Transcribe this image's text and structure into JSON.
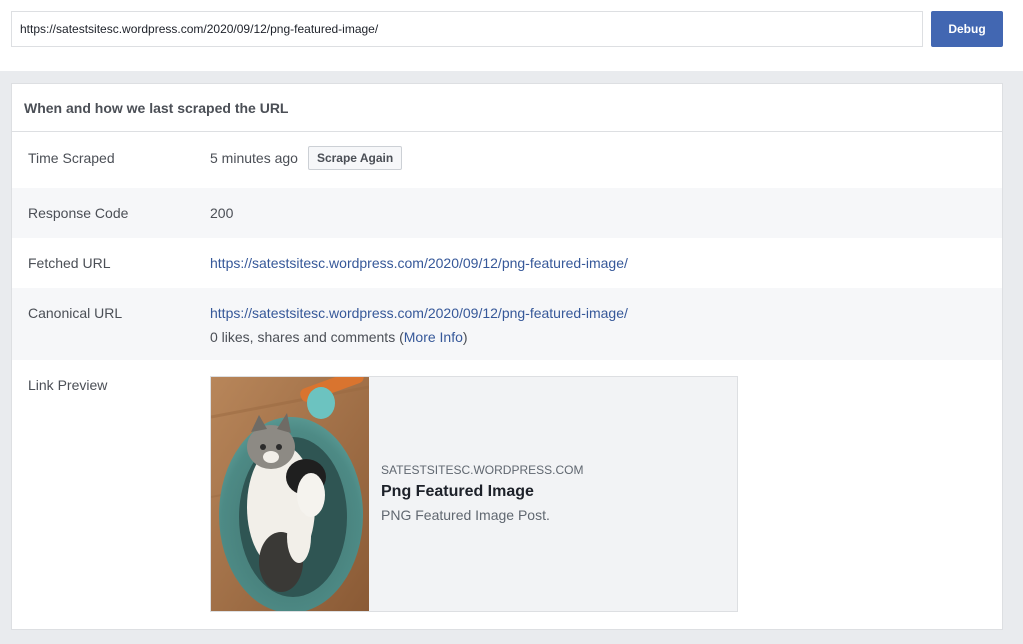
{
  "search": {
    "url_value": "https://satestsitesc.wordpress.com/2020/09/12/png-featured-image/",
    "debug_label": "Debug"
  },
  "panel": {
    "header": "When and how we last scraped the URL",
    "time_scraped": {
      "label": "Time Scraped",
      "value": "5 minutes ago",
      "button": "Scrape Again"
    },
    "response_code": {
      "label": "Response Code",
      "value": "200"
    },
    "fetched_url": {
      "label": "Fetched URL",
      "value": "https://satestsitesc.wordpress.com/2020/09/12/png-featured-image/"
    },
    "canonical_url": {
      "label": "Canonical URL",
      "value": "https://satestsitesc.wordpress.com/2020/09/12/png-featured-image/",
      "stats_prefix": "0 likes, shares and comments (",
      "more_info": "More Info",
      "stats_suffix": ")"
    },
    "link_preview": {
      "label": "Link Preview",
      "domain": "SATESTSITESC.WORDPRESS.COM",
      "title": "Png Featured Image",
      "description": "PNG Featured Image Post."
    }
  },
  "colors": {
    "accent": "#4267b2",
    "link": "#365899",
    "background": "#e9ebee"
  }
}
